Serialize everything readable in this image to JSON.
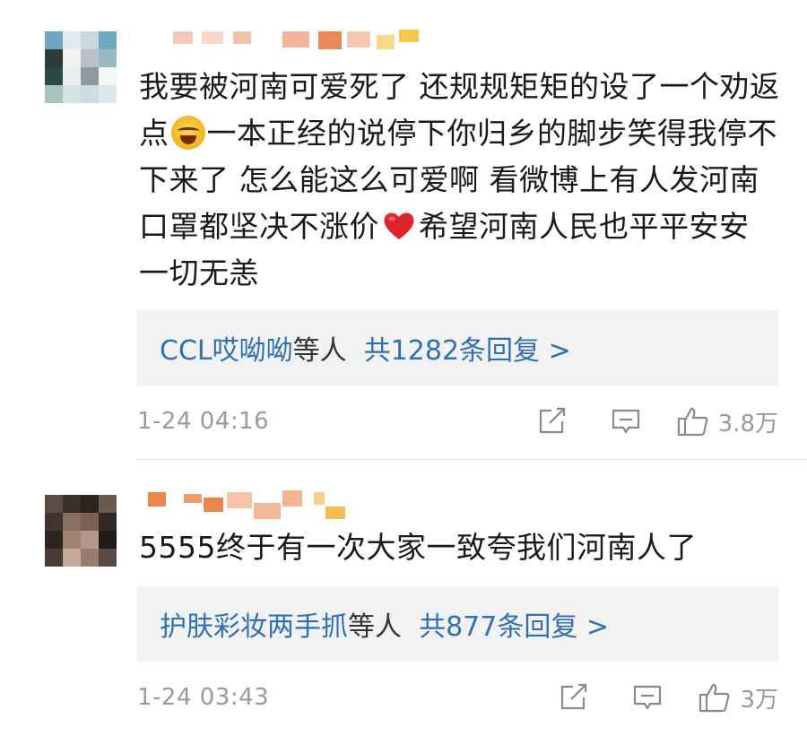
{
  "comments": [
    {
      "text_part1": "我要被河南可爱死了 还规规矩矩的设了一个劝返点",
      "emoji1": "crying-laughing-emoji",
      "text_part2": "一本正经的说停下你归乡的脚步笑得我停不下来了 怎么能这么可爱啊 看微博上有人发河南口罩都坚决不涨价",
      "emoji2": "red-heart-emoji",
      "text_part3": "希望河南人民也平平安安 一切无恙",
      "reply_user": "CCL哎呦呦",
      "reply_etc": "等人",
      "reply_count": "共1282条回复 >",
      "time": "1-24 04:16",
      "likes": "3.8万"
    },
    {
      "text": "5555终于有一次大家一致夸我们河南人了",
      "reply_user": "护肤彩妆两手抓",
      "reply_etc": "等人",
      "reply_count": "共877条回复 >",
      "time": "1-24 03:43",
      "likes": "3万"
    }
  ],
  "icons": {
    "share": "share-icon",
    "comment": "comment-icon",
    "like": "thumbs-up-icon"
  },
  "colors": {
    "link": "#2f6fb5",
    "meta": "#9a9a9a",
    "reply_bg": "#f2f2f2"
  }
}
